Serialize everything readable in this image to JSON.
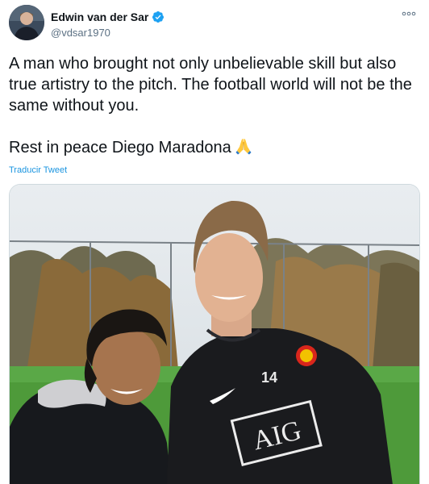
{
  "author": {
    "display_name": "Edwin van der Sar",
    "handle": "@vdsar1970",
    "verified": true,
    "avatar_icon": "profile-photo"
  },
  "tweet": {
    "paragraph1": "A man who brought not only unbelievable skill but also true artistry to the pitch. The football world will not be the same without you.",
    "paragraph2": "Rest in peace Diego Maradona",
    "emoji": "folded-hands"
  },
  "translate_label": "Traducir Tweet",
  "more_icon": "more-options-icon",
  "photo": {
    "shirt_number": "14",
    "sponsor": "AIG"
  },
  "colors": {
    "accent": "#1b95e0",
    "verified": "#1da1f2",
    "secondary_text": "#5b7083",
    "border": "#cfd9de"
  }
}
